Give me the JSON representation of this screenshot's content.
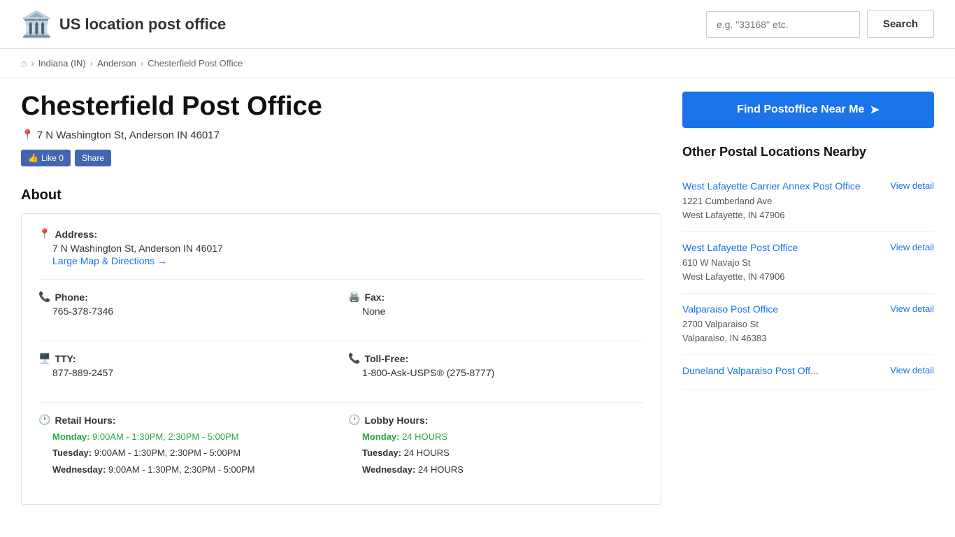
{
  "header": {
    "logo_icon": "🏛️",
    "logo_text": "US location post office",
    "search_placeholder": "e.g. \"33168\" etc.",
    "search_label": "Search"
  },
  "breadcrumb": {
    "home_icon": "⌂",
    "items": [
      {
        "label": "Indiana (IN)",
        "href": "#"
      },
      {
        "label": "Anderson",
        "href": "#"
      },
      {
        "label": "Chesterfield Post Office",
        "href": "#"
      }
    ]
  },
  "page": {
    "title": "Chesterfield Post Office",
    "address": "7 N Washington St, Anderson IN 46017",
    "fb_like": "Like 0",
    "fb_share": "Share"
  },
  "about": {
    "section_title": "About",
    "address_label": "Address:",
    "address_value": "7 N Washington St, Anderson IN 46017",
    "map_link": "Large Map & Directions →",
    "phone_label": "Phone:",
    "phone_value": "765-378-7346",
    "fax_label": "Fax:",
    "fax_value": "None",
    "tty_label": "TTY:",
    "tty_value": "877-889-2457",
    "tollfree_label": "Toll-Free:",
    "tollfree_value": "1-800-Ask-USPS® (275-8777)",
    "retail_hours_label": "Retail Hours:",
    "retail_hours": [
      {
        "day": "Monday:",
        "hours": "9:00AM - 1:30PM, 2:30PM - 5:00PM",
        "highlight": true
      },
      {
        "day": "Tuesday:",
        "hours": "9:00AM - 1:30PM, 2:30PM - 5:00PM",
        "highlight": false
      },
      {
        "day": "Wednesday:",
        "hours": "9:00AM - 1:30PM, 2:30PM - 5:00PM",
        "highlight": false
      }
    ],
    "lobby_hours_label": "Lobby Hours:",
    "lobby_hours": [
      {
        "day": "Monday:",
        "hours": "24 HOURS",
        "highlight": true
      },
      {
        "day": "Tuesday:",
        "hours": "24 HOURS",
        "highlight": false
      },
      {
        "day": "Wednesday:",
        "hours": "24 HOURS",
        "highlight": false
      }
    ]
  },
  "sidebar": {
    "find_btn_label": "Find Postoffice Near Me",
    "nearby_title": "Other Postal Locations Nearby",
    "nearby_locations": [
      {
        "name": "West Lafayette Carrier Annex Post Office",
        "address1": "1221 Cumberland Ave",
        "address2": "West Lafayette, IN 47906",
        "link_label": "View detail"
      },
      {
        "name": "West Lafayette Post Office",
        "address1": "610 W Navajo St",
        "address2": "West Lafayette, IN 47906",
        "link_label": "View detail"
      },
      {
        "name": "Valparaiso Post Office",
        "address1": "2700 Valparaiso St",
        "address2": "Valparaiso, IN 46383",
        "link_label": "View detail"
      },
      {
        "name": "Duneland Valparaiso Post Off...",
        "address1": "",
        "address2": "",
        "link_label": "View detail"
      }
    ]
  }
}
